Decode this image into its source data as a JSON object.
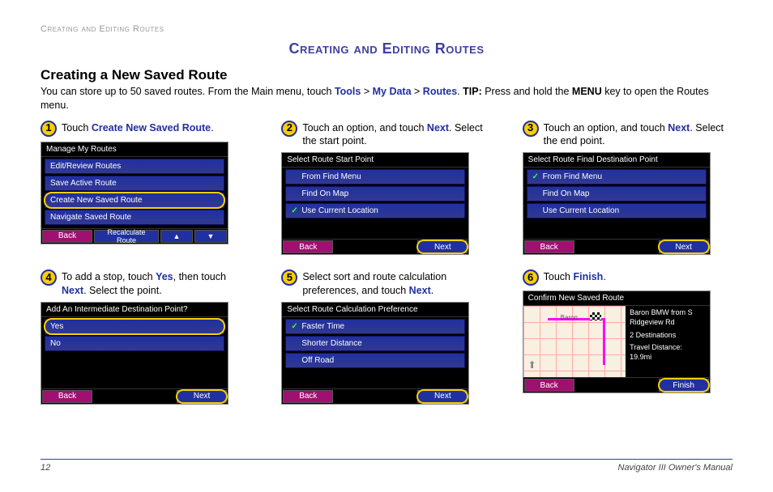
{
  "breadcrumb": "Creating and Editing Routes",
  "pageTitle": "Creating and Editing Routes",
  "sectionTitle": "Creating a New Saved Route",
  "intro": {
    "pre": "You can store up to 50 saved routes. From the Main menu, touch ",
    "nav1": "Tools",
    "gt1": " > ",
    "nav2": "My Data",
    "gt2": " > ",
    "nav3": "Routes",
    "post1": ". ",
    "tipLabel": "TIP:",
    "post2": " Press and hold the ",
    "menuKey": "MENU",
    "post3": " key to open the Routes menu."
  },
  "steps": {
    "s1": {
      "num": "1",
      "pre": "Touch ",
      "link": "Create New Saved Route",
      "post": "."
    },
    "s2": {
      "num": "2",
      "pre": "Touch an option, and touch ",
      "link": "Next",
      "post": ". Select the start point."
    },
    "s3": {
      "num": "3",
      "pre": "Touch an option, and touch ",
      "link": "Next",
      "post": ". Select the end point."
    },
    "s4": {
      "num": "4",
      "pre": "To add a stop, touch ",
      "link1": "Yes",
      "mid": ", then touch ",
      "link2": "Next",
      "post": ". Select the point."
    },
    "s5": {
      "num": "5",
      "pre": "Select sort and route calculation preferences, and touch ",
      "link": "Next",
      "post": "."
    },
    "s6": {
      "num": "6",
      "pre": "Touch ",
      "link": "Finish",
      "post": "."
    }
  },
  "screens": {
    "s1": {
      "title": "Manage My Routes",
      "rows": [
        "Edit/Review Routes",
        "Save Active Route",
        "Create New Saved Route",
        "Navigate Saved Route"
      ],
      "highlightRow": 2,
      "back": "Back",
      "recalc": "Recalculate Route",
      "up": "▲",
      "down": "▼"
    },
    "s2": {
      "title": "Select Route Start Point",
      "rows": [
        "From Find Menu",
        "Find On Map",
        "Use Current Location"
      ],
      "checkRow": 2,
      "back": "Back",
      "next": "Next",
      "highlightNext": true
    },
    "s3": {
      "title": "Select Route Final Destination Point",
      "rows": [
        "From Find Menu",
        "Find On Map",
        "Use Current Location"
      ],
      "checkRow": 0,
      "back": "Back",
      "next": "Next",
      "highlightNext": true
    },
    "s4": {
      "title": "Add An Intermediate Destination Point?",
      "rows": [
        "Yes",
        "No"
      ],
      "highlightRow": 0,
      "back": "Back",
      "next": "Next",
      "highlightNext": true
    },
    "s5": {
      "title": "Select Route Calculation Preference",
      "rows": [
        "Faster Time",
        "Shorter Distance",
        "Off Road"
      ],
      "checkRow": 0,
      "back": "Back",
      "next": "Next",
      "highlightNext": true
    },
    "s6": {
      "title": "Confirm New Saved Route",
      "info1": "Baron BMW from S Ridgeview Rd",
      "info2": "2 Destinations",
      "info3": "Travel Distance: 19.9mi",
      "back": "Back",
      "finish": "Finish",
      "highlightFinish": true,
      "baron": "Baron"
    }
  },
  "footer": {
    "pageNum": "12",
    "manual": "Navigator III Owner's Manual"
  }
}
